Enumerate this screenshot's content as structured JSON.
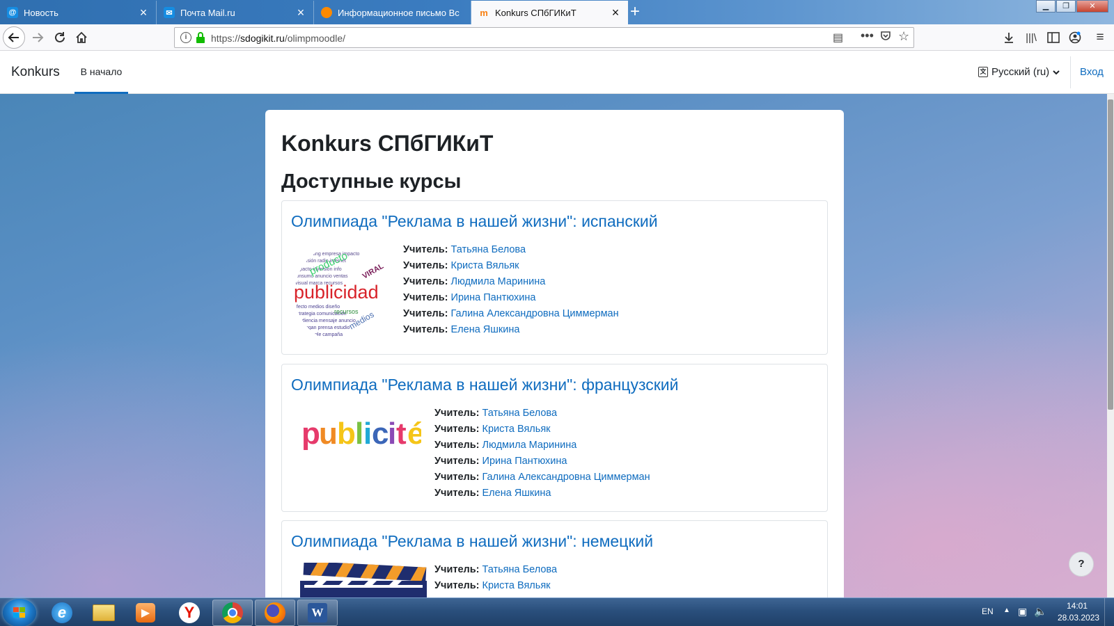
{
  "browser": {
    "tabs": [
      {
        "label": "Новость",
        "favicon": "mail-at-icon",
        "favicon_color": "#168de2",
        "active": false
      },
      {
        "label": "Почта Mail.ru",
        "favicon": "envelope-icon",
        "favicon_color": "#168de2",
        "active": false
      },
      {
        "label": "Информационное письмо Вс",
        "favicon": "cloud-icon",
        "favicon_color": "#ff8a00",
        "active": false
      },
      {
        "label": "Konkurs СПбГИКиТ",
        "favicon": "moodle-icon",
        "favicon_color": "#f98012",
        "active": true
      }
    ],
    "url_prefix": "https://",
    "url_host": "sdogikit.ru",
    "url_path": "/olimpmoodle/"
  },
  "site": {
    "brand": "Konkurs",
    "home_link": "В начало",
    "language": "Русский (ru)",
    "login": "Вход",
    "title": "Konkurs СПбГИКиТ",
    "courses_heading": "Доступные курсы",
    "role_label": "Учитель:"
  },
  "courses": [
    {
      "name": "Олимпиада \"Реклама в нашей жизни\": испанский",
      "image_text": "publicidad",
      "teachers": [
        "Татьяна Белова",
        "Криста Вяльяк",
        "Людмила Маринина",
        "Ирина Пантюхина",
        "Галина Александровна Циммерман",
        "Елена Яшкина"
      ]
    },
    {
      "name": "Олимпиада \"Реклама в нашей жизни\": французский",
      "image_text": "publicité",
      "teachers": [
        "Татьяна Белова",
        "Криста Вяльяк",
        "Людмила Маринина",
        "Ирина Пантюхина",
        "Галина Александровна Циммерман",
        "Елена Яшкина"
      ]
    },
    {
      "name": "Олимпиада \"Реклама в нашей жизни\": немецкий",
      "teachers": [
        "Татьяна Белова",
        "Криста Вяльяк"
      ]
    }
  ],
  "help_label": "?",
  "taskbar": {
    "lang": "EN",
    "time": "14:01",
    "date": "28.03.2023"
  }
}
